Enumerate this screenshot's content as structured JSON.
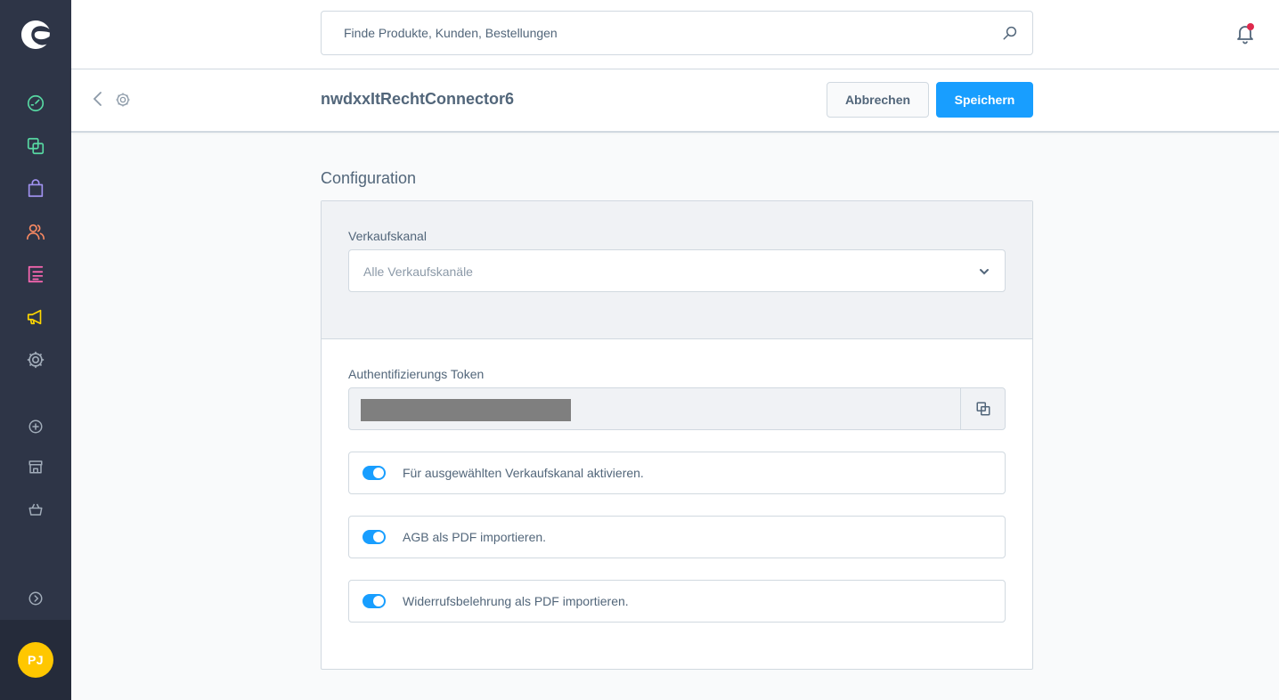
{
  "sidebar": {
    "icons": [
      "dashboard-icon",
      "catalogues-icon",
      "orders-icon",
      "customers-icon",
      "content-icon",
      "marketing-icon",
      "settings-icon",
      "extensions-add-icon",
      "sales-channel-storefront-icon",
      "sales-channel-headless-icon",
      "collapse-menu-icon"
    ],
    "avatar_initials": "PJ",
    "colors": {
      "background": "#2e3547",
      "dashboard": "#57d9a3",
      "catalogues": "#57d9a3",
      "orders": "#a092f0",
      "customers": "#f88962",
      "content": "#ff68b4",
      "marketing": "#ffd700",
      "avatar": "#ffc700"
    }
  },
  "search": {
    "placeholder": "Finde Produkte, Kunden, Bestellungen"
  },
  "smartbar": {
    "title": "nwdxxItRechtConnector6",
    "cancel_label": "Abbrechen",
    "save_label": "Speichern"
  },
  "content": {
    "section_title": "Configuration",
    "sales_channel_label": "Verkaufskanal",
    "sales_channel_value": "Alle Verkaufskanäle",
    "token_label": "Authentifizierungs Token",
    "switches": [
      {
        "label": "Für ausgewählten Verkaufskanal aktivieren.",
        "checked": true
      },
      {
        "label": "AGB als PDF importieren.",
        "checked": true
      },
      {
        "label": "Widerrufsbelehrung als PDF importieren.",
        "checked": true
      }
    ]
  },
  "colors": {
    "primary": "#189eff",
    "notification_dot": "#de294c",
    "text": "#52667a"
  }
}
